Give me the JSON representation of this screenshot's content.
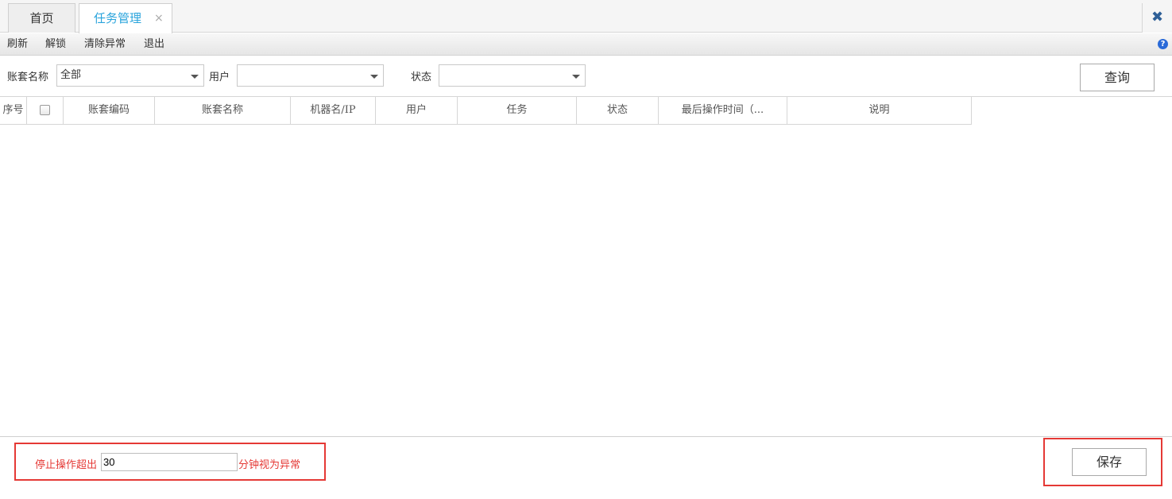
{
  "tabs": [
    {
      "label": "首页"
    },
    {
      "label": "任务管理",
      "close": "×"
    }
  ],
  "window": {
    "close_glyph": "✖"
  },
  "toolbar": {
    "items": [
      "刷新",
      "解锁",
      "清除异常",
      "退出"
    ],
    "help_glyph": "?"
  },
  "filter": {
    "account_label": "账套名称",
    "account_value": "全部",
    "user_label": "用户",
    "user_value": "",
    "status_label": "状态",
    "status_value": "",
    "query_button": "查询"
  },
  "grid": {
    "columns": [
      "序号",
      "",
      "账套编码",
      "账套名称",
      "机器名/IP",
      "用户",
      "任务",
      "状态",
      "最后操作时间（...",
      "说明"
    ],
    "rows": []
  },
  "footer": {
    "stop_label": "停止操作超出",
    "minutes_value": "30",
    "suffix_label": "分钟视为异常",
    "save_button": "保存"
  },
  "colors": {
    "accent_tab": "#2aa4dc",
    "highlight_box": "#e53935",
    "close_icon": "#2e5f97"
  }
}
